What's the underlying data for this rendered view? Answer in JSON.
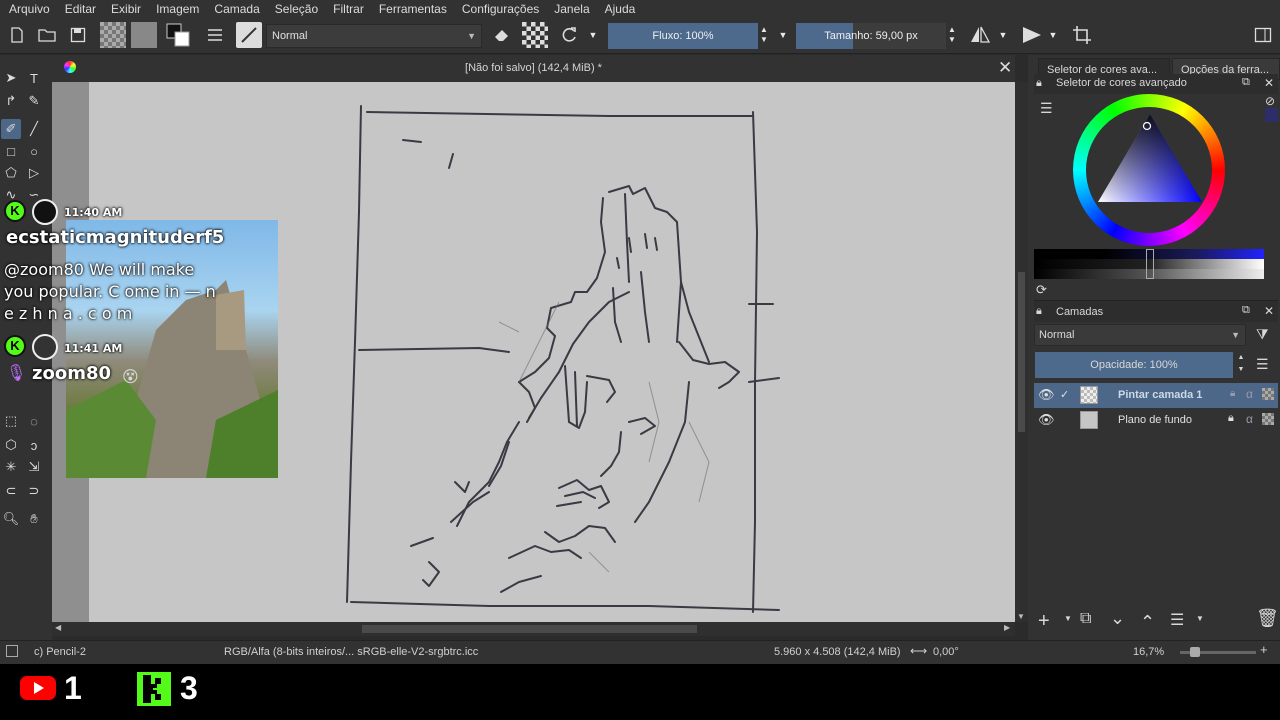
{
  "menu": [
    "Arquivo",
    "Editar",
    "Exibir",
    "Imagem",
    "Camada",
    "Seleção",
    "Filtrar",
    "Ferramentas",
    "Configurações",
    "Janela",
    "Ajuda"
  ],
  "toolbar": {
    "blend_mode": "Normal",
    "flow_label": "Fluxo: 100%",
    "size_label": "Tamanho: 59,00 px"
  },
  "document": {
    "title": "[Não foi salvo]  (142,4 MiB) *"
  },
  "right_panel": {
    "tabs": [
      "Seletor de cores ava...",
      "Opções da ferra..."
    ],
    "color_selector_title": "Seletor de cores avançado",
    "layers_title": "Camadas",
    "layers_blend": "Normal",
    "opacity_label": "Opacidade:  100%",
    "layers": [
      {
        "name": "Pintar camada 1",
        "selected": true
      },
      {
        "name": "Plano de fundo",
        "selected": false
      }
    ]
  },
  "status": {
    "brush": "c) Pencil-2",
    "color_model": "RGB/Alfa (8-bits inteiros/...  sRGB-elle-V2-srgbtrc.icc",
    "image_size": "5.960 x 4.508 (142,4 MiB)",
    "rotation": "0,00°",
    "zoom": "16,7%"
  },
  "chat": {
    "messages": [
      {
        "time": "11:40 AM",
        "user": "ecstaticmagnituderf5",
        "text": "@zoom80 We will make you popular. C ome in — n e z h n a . c o m"
      },
      {
        "time": "11:41 AM",
        "user": "zoom80",
        "text": ""
      }
    ]
  },
  "stream_counts": {
    "youtube": "1",
    "kick": "3"
  },
  "colors": {
    "accent": "#4c6788",
    "kick_green": "#53fc18",
    "youtube_red": "#ff0000"
  }
}
